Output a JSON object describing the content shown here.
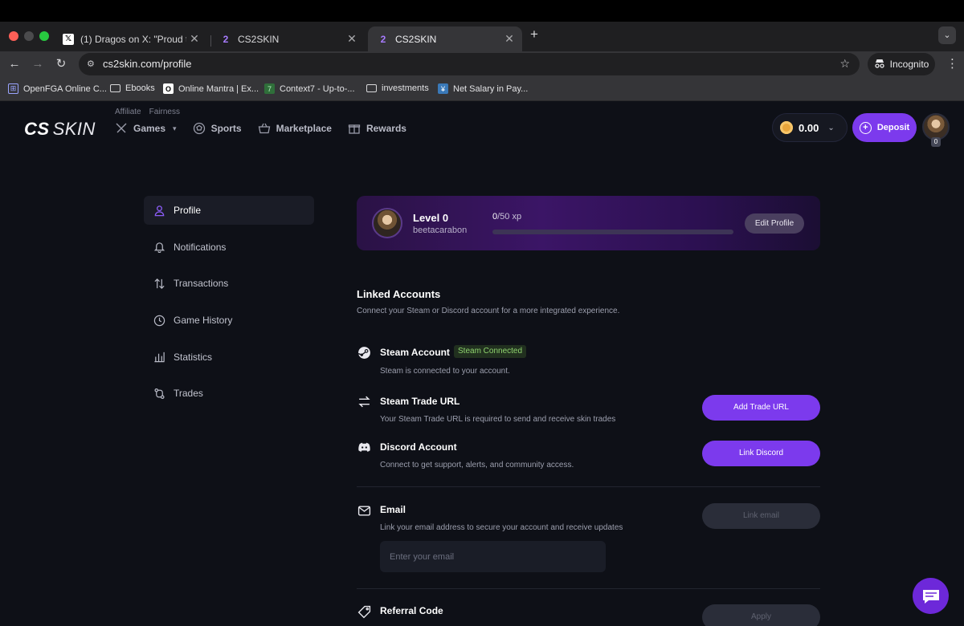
{
  "browser": {
    "tabs": [
      {
        "title": "(1) Dragos on X: \"Proud to lau",
        "favicon": "x-logo-icon"
      },
      {
        "title": "CS2SKIN",
        "favicon": "cs2skin-icon"
      },
      {
        "title": "CS2SKIN",
        "favicon": "cs2skin-icon",
        "active": true
      }
    ],
    "url": "cs2skin.com/profile",
    "incognito_label": "Incognito",
    "bookmarks": [
      {
        "label": "OpenFGA Online C...",
        "icon": "openfga-icon"
      },
      {
        "label": "Ebooks",
        "icon": "folder-icon"
      },
      {
        "label": "Online Mantra | Ex...",
        "icon": "om-icon"
      },
      {
        "label": "Context7 - Up-to-...",
        "icon": "context7-icon"
      },
      {
        "label": "investments",
        "icon": "folder-icon"
      },
      {
        "label": "Net Salary in Pay...",
        "icon": "salary-icon"
      }
    ]
  },
  "site": {
    "logo_cs": "CS",
    "logo_skin": "SKIN",
    "toplinks": [
      "Affiliate",
      "Fairness"
    ],
    "nav": [
      {
        "label": "Games",
        "icon": "swords-icon",
        "dropdown": true
      },
      {
        "label": "Sports",
        "icon": "ball-icon"
      },
      {
        "label": "Marketplace",
        "icon": "basket-icon"
      },
      {
        "label": "Rewards",
        "icon": "gift-icon"
      }
    ],
    "balance": "0.00",
    "deposit_label": "Deposit",
    "user_level_badge": "0"
  },
  "sidebar": {
    "items": [
      {
        "label": "Profile",
        "icon": "user-icon",
        "active": true
      },
      {
        "label": "Notifications",
        "icon": "bell-icon"
      },
      {
        "label": "Transactions",
        "icon": "arrows-icon"
      },
      {
        "label": "Game History",
        "icon": "clock-icon"
      },
      {
        "label": "Statistics",
        "icon": "bar-chart-icon"
      },
      {
        "label": "Trades",
        "icon": "trade-icon"
      }
    ]
  },
  "profile": {
    "level": "Level 0",
    "username": "beetacarabon",
    "xp_current": "0",
    "xp_total": "/50 xp",
    "xp_progress": 0,
    "edit_label": "Edit Profile"
  },
  "linked": {
    "title": "Linked Accounts",
    "subtitle": "Connect your Steam or Discord account for a more integrated experience.",
    "steam": {
      "title": "Steam Account",
      "badge": "Steam Connected",
      "desc": "Steam is connected to your account."
    },
    "trade": {
      "title": "Steam Trade URL",
      "desc": "Your Steam Trade URL is required to send and receive skin trades",
      "button": "Add Trade URL"
    },
    "discord": {
      "title": "Discord Account",
      "desc": "Connect to get support, alerts, and community access.",
      "button": "Link Discord"
    },
    "email": {
      "title": "Email",
      "desc": "Link your email address to secure your account and receive updates",
      "button": "Link email",
      "placeholder": "Enter your email"
    },
    "referral": {
      "title": "Referral Code",
      "button": "Apply"
    }
  },
  "colors": {
    "accent": "#7c3aed",
    "badge_text": "#8fd46e",
    "page_bg": "#0e1017"
  }
}
